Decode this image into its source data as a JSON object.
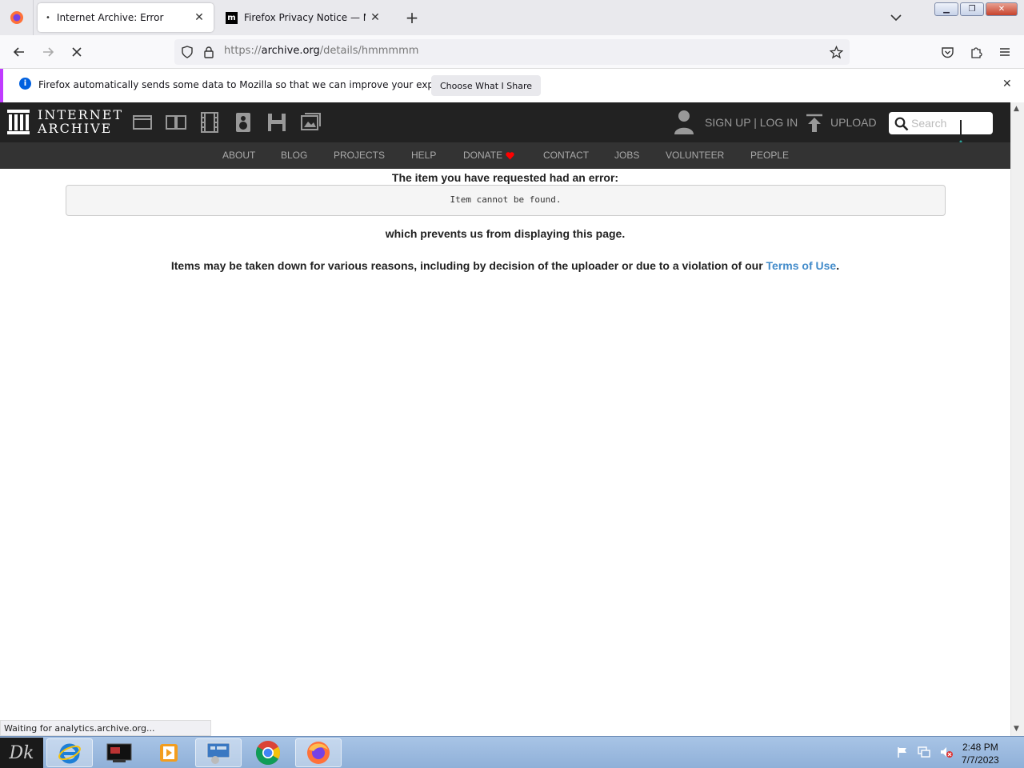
{
  "browser": {
    "tabs": [
      {
        "title": "Internet Archive: Error",
        "active": true
      },
      {
        "title": "Firefox Privacy Notice — Mozilla",
        "active": false
      }
    ],
    "url_scheme": "https://",
    "url_host": "archive.org",
    "url_path": "/details/hmmmmm",
    "status_text": "Waiting for analytics.archive.org..."
  },
  "notification": {
    "message": "Firefox automatically sends some data to Mozilla so that we can improve your experience.",
    "button": "Choose What I Share"
  },
  "ia": {
    "logo_line1": "INTERNET",
    "logo_line2": "ARCHIVE",
    "signup": "SIGN UP | LOG IN",
    "upload": "UPLOAD",
    "search_placeholder": "Search",
    "nav": [
      "ABOUT",
      "BLOG",
      "PROJECTS",
      "HELP",
      "DONATE",
      "CONTACT",
      "JOBS",
      "VOLUNTEER",
      "PEOPLE"
    ],
    "colors": {
      "header": "#222222",
      "nav": "#333333",
      "donate_heart": "#ff0000"
    }
  },
  "content": {
    "error_heading": "The item you have requested had an error:",
    "error_message": "Item cannot be found.",
    "prevents": "which prevents us from displaying this page.",
    "reasons": "Items may be taken down for various reasons, including by decision of the uploader or due to a violation of our",
    "terms_link": "Terms of Use",
    "period": "."
  },
  "taskbar": {
    "time": "2:48 PM",
    "date": "7/7/2023",
    "start_label": "Dk",
    "apps": [
      "internet-explorer-icon",
      "media-center-icon",
      "media-player-icon",
      "control-panel-icon",
      "chrome-icon",
      "firefox-icon"
    ]
  }
}
